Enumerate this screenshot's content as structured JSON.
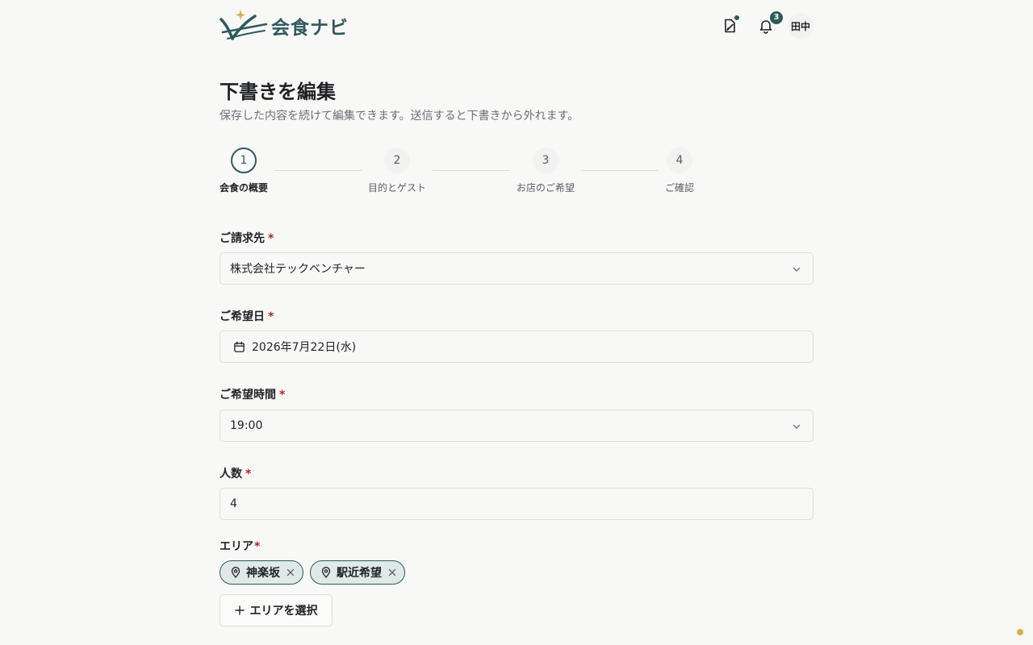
{
  "app": {
    "brand": "会食ナビ",
    "notification_count": "3",
    "user_name": "田中",
    "brand_color": "#2f5a5c",
    "accent_color": "#d4b14a"
  },
  "page": {
    "title": "下書きを編集",
    "subtitle": "保存した内容を続けて編集できます。送信すると下書きから外れます。"
  },
  "stepper": {
    "current": 1,
    "steps": [
      {
        "number": "1",
        "label": "会食の概要"
      },
      {
        "number": "2",
        "label": "目的とゲスト"
      },
      {
        "number": "3",
        "label": "お店のご希望"
      },
      {
        "number": "4",
        "label": "ご確認"
      }
    ]
  },
  "form": {
    "required_mark": "*",
    "billing": {
      "label": "ご請求先",
      "value": "株式会社テックベンチャー"
    },
    "date": {
      "label": "ご希望日",
      "value": "2026年7月22日(水)"
    },
    "time": {
      "label": "ご希望時間",
      "value": "19:00"
    },
    "people": {
      "label": "人数",
      "value": "4"
    },
    "area": {
      "label": "エリア",
      "chips": [
        "神楽坂",
        "駅近希望"
      ],
      "add_label": "エリアを選択"
    }
  },
  "icons": {
    "draft": "edit-document-icon",
    "notifications": "bell-icon",
    "calendar": "calendar-icon",
    "chevron": "chevron-down-icon",
    "pin": "map-pin-icon",
    "remove": "close-icon",
    "add": "plus-icon"
  }
}
